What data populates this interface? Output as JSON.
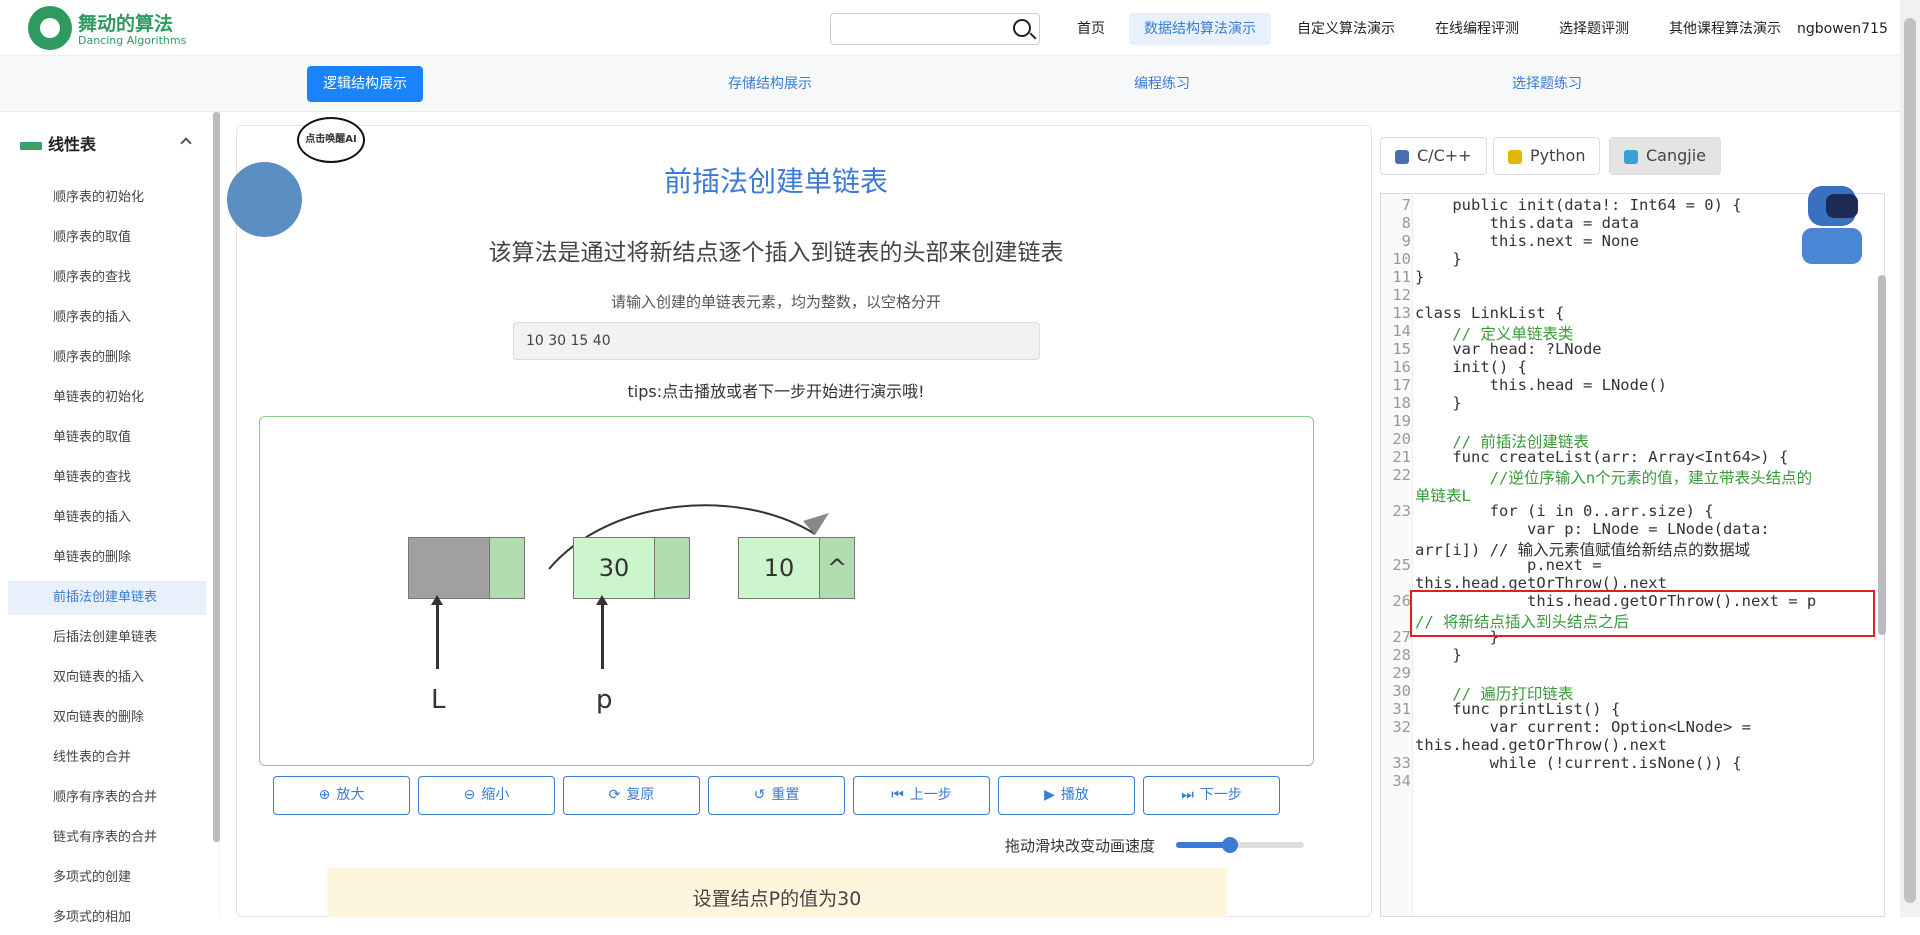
{
  "brand": {
    "cn": "舞动的算法",
    "en": "Dancing Algorithms"
  },
  "nav": {
    "items": [
      "首页",
      "数据结构算法演示",
      "自定义算法演示",
      "在线编程评测",
      "选择题评测",
      "其他课程算法演示"
    ],
    "active": "数据结构算法演示",
    "user": "ngbowen715"
  },
  "tabs": {
    "items": [
      "逻辑结构展示",
      "存储结构展示",
      "编程练习",
      "选择题练习"
    ],
    "active": "逻辑结构展示"
  },
  "sidebar": {
    "heading": "线性表",
    "items": [
      "顺序表的初始化",
      "顺序表的取值",
      "顺序表的查找",
      "顺序表的插入",
      "顺序表的删除",
      "单链表的初始化",
      "单链表的取值",
      "单链表的查找",
      "单链表的插入",
      "单链表的删除",
      "前插法创建单链表",
      "后插法创建单链表",
      "双向链表的插入",
      "双向链表的删除",
      "线性表的合并",
      "顺序有序表的合并",
      "链式有序表的合并",
      "多项式的创建",
      "多项式的相加"
    ],
    "active_index": 10
  },
  "ai_bubble": "点击唤醒AI",
  "main": {
    "title": "前插法创建单链表",
    "description": "该算法是通过将新结点逐个插入到链表的头部来创建链表",
    "input_prompt": "请输入创建的单链表元素，均为整数，以空格分开",
    "input_value": "10 30 15 40",
    "tips": "tips:点击播放或者下一步开始进行演示哦!",
    "status": "设置结点P的值为30",
    "speed_label": "拖动滑块改变动画速度",
    "speed_value": 0.42
  },
  "viz": {
    "nodes": [
      {
        "data": "",
        "next": "",
        "data_color": "#a0a0a0",
        "next_color": "#b0dcb0"
      },
      {
        "data": "30",
        "next": "",
        "data_color": "#ccf5cc",
        "next_color": "#b0dcb0"
      },
      {
        "data": "10",
        "next": "^",
        "data_color": "#ccf5cc",
        "next_color": "#b0dcb0"
      }
    ],
    "pointers": [
      "L",
      "p"
    ]
  },
  "controls": [
    "放大",
    "缩小",
    "复原",
    "重置",
    "上一步",
    "播放",
    "下一步"
  ],
  "control_icons": [
    "zoom-in-icon",
    "zoom-out-icon",
    "refresh-icon",
    "undo-icon",
    "step-back-icon",
    "play-icon",
    "step-forward-icon"
  ],
  "languages": {
    "items": [
      "C/C++",
      "Python",
      "Cangjie"
    ],
    "active": "Cangjie"
  },
  "code": {
    "lines": [
      {
        "n": "7",
        "t": "    public init(data!: Int64 = 0) {"
      },
      {
        "n": "8",
        "t": "        this.data = data"
      },
      {
        "n": "9",
        "t": "        this.next = None"
      },
      {
        "n": "10",
        "t": "    }"
      },
      {
        "n": "11",
        "t": "}"
      },
      {
        "n": "12",
        "t": ""
      },
      {
        "n": "13",
        "t": "class LinkList {"
      },
      {
        "n": "14",
        "t": "    // 定义单链表类"
      },
      {
        "n": "15",
        "t": "    var head: ?LNode"
      },
      {
        "n": "16",
        "t": "    init() {"
      },
      {
        "n": "17",
        "t": "        this.head = LNode()"
      },
      {
        "n": "18",
        "t": "    }"
      },
      {
        "n": "19",
        "t": ""
      },
      {
        "n": "20",
        "t": "    // 前插法创建链表"
      },
      {
        "n": "21",
        "t": "    func createList(arr: Array<Int64>) {"
      },
      {
        "n": "22",
        "t": "        //逆位序输入n个元素的值，建立带表头结点的"
      },
      {
        "n": "",
        "t": "单链表L"
      },
      {
        "n": "23",
        "t": "        for (i in 0..arr.size) {"
      },
      {
        "n": "",
        "t": "            var p: LNode = LNode(data:"
      },
      {
        "n": "",
        "t": "arr[i]) // 输入元素值赋值给新结点的数据域"
      },
      {
        "n": "25",
        "t": "            p.next ="
      },
      {
        "n": "",
        "t": "this.head.getOrThrow().next"
      },
      {
        "n": "26",
        "t": "            this.head.getOrThrow().next = p"
      },
      {
        "n": "",
        "t": "// 将新结点插入到头结点之后"
      },
      {
        "n": "27",
        "t": "        }"
      },
      {
        "n": "28",
        "t": "    }"
      },
      {
        "n": "29",
        "t": ""
      },
      {
        "n": "30",
        "t": "    // 遍历打印链表"
      },
      {
        "n": "31",
        "t": "    func printList() {"
      },
      {
        "n": "32",
        "t": "        var current: Option<LNode> ="
      },
      {
        "n": "",
        "t": "this.head.getOrThrow().next"
      },
      {
        "n": "33",
        "t": "        while (!current.isNone()) {"
      },
      {
        "n": "34",
        "t": ""
      }
    ]
  },
  "colors": {
    "accent": "#1a84ff",
    "brand": "#2e9a5f",
    "highlight": "#e02020"
  }
}
